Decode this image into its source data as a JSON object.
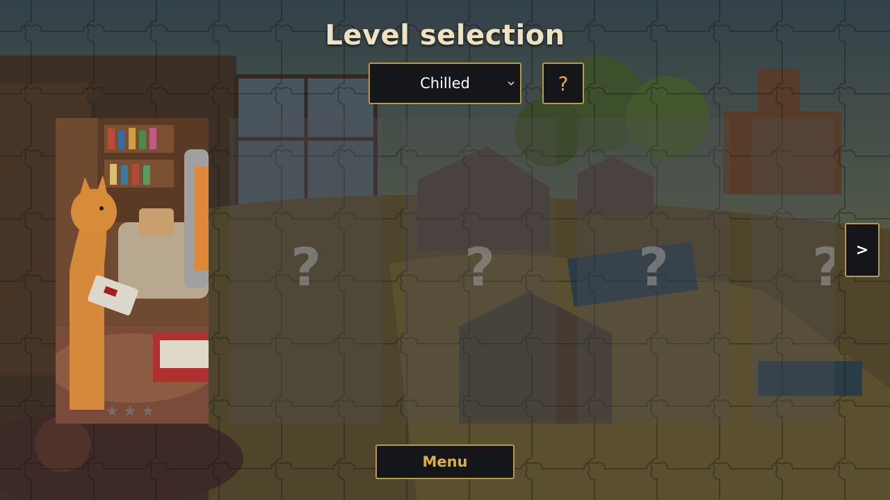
{
  "screen": {
    "title": "Level selection"
  },
  "difficulty": {
    "selected": "Chilled"
  },
  "help_button": {
    "label": "?"
  },
  "levels": [
    {
      "state": "unlocked",
      "stars": "★★★",
      "thumbnail": "cat-playing-retro-console"
    },
    {
      "state": "locked",
      "placeholder": "?"
    },
    {
      "state": "locked",
      "placeholder": "?"
    },
    {
      "state": "locked",
      "placeholder": "?"
    },
    {
      "state": "locked",
      "placeholder": "?"
    }
  ],
  "next_button": {
    "label": ">"
  },
  "menu_button": {
    "label": "Menu"
  },
  "colors": {
    "accent_gold": "#d9b04a",
    "border_gold": "#b99a4d",
    "button_bg": "#15161a",
    "title_text": "#eee2c0"
  }
}
